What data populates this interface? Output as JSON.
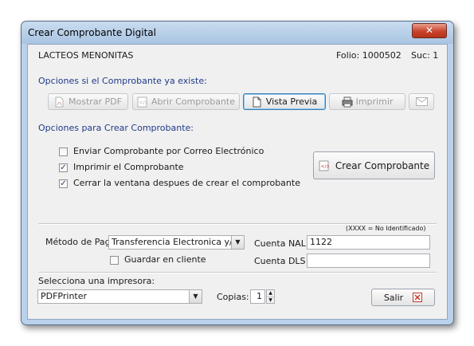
{
  "window": {
    "title": "Crear Comprobante Digital",
    "close_glyph": "✕"
  },
  "header": {
    "company": "LACTEOS MENONITAS",
    "folio": "Folio: 1000502",
    "suc": "Suc: 1"
  },
  "existing_section": {
    "title": "Opciones si el Comprobante ya existe:",
    "buttons": {
      "mostrar_pdf": "Mostrar PDF",
      "abrir_comprobante": "Abrir Comprobante",
      "vista_previa": "Vista Previa",
      "imprimir": "Imprimir"
    }
  },
  "create_section": {
    "title": "Opciones para Crear Comprobante:",
    "options": [
      {
        "label": "Enviar Comprobante por Correo Electrónico",
        "checked": false
      },
      {
        "label": "Imprimir el Comprobante",
        "checked": true
      },
      {
        "label": "Cerrar la ventana despues de crear el comprobante",
        "checked": true
      }
    ],
    "create_button": "Crear Comprobante"
  },
  "payment": {
    "note": "(XXXX = No Identificado)",
    "metodo_label": "Método de Pago",
    "metodo_value": "Transferencia Electronica y/o",
    "guardar_label": "Guardar en cliente",
    "guardar_checked": false,
    "cuenta_nal_label": "Cuenta NAL",
    "cuenta_nal_value": "1122",
    "cuenta_dls_label": "Cuenta DLS",
    "cuenta_dls_value": ""
  },
  "printer": {
    "label": "Selecciona una impresora:",
    "selected": "PDFPrinter",
    "copias_label": "Copias:",
    "copias_value": "1"
  },
  "footer": {
    "salir": "Salir"
  },
  "colors": {
    "section_title": "#1e3a8a",
    "window_frame": "#b9d1ea",
    "close_button": "#c7432b"
  }
}
